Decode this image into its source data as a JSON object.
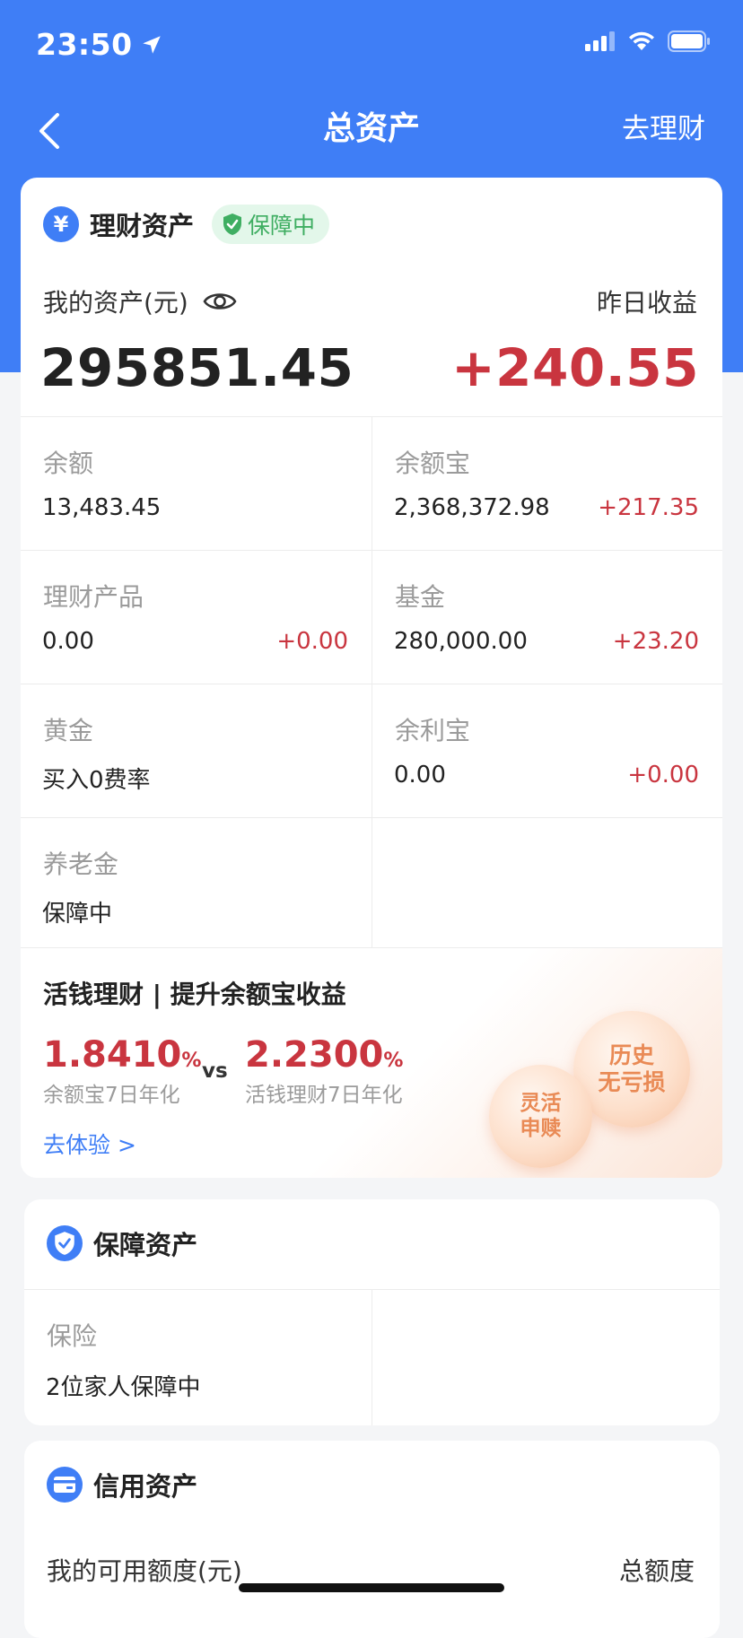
{
  "status_bar": {
    "time": "23:50"
  },
  "nav": {
    "title": "总资产",
    "action": "去理财"
  },
  "finance": {
    "title": "理财资产",
    "icon_glyph": "¥",
    "badge": "保障中",
    "assets_label": "我的资产(元)",
    "yesterday_label": "昨日收益",
    "total": "295851.45",
    "yesterday_income": "+240.55",
    "items": [
      {
        "label": "余额",
        "value": "13,483.45",
        "delta": ""
      },
      {
        "label": "余额宝",
        "value": "2,368,372.98",
        "delta": "+217.35"
      },
      {
        "label": "理财产品",
        "value": "0.00",
        "delta": "+0.00"
      },
      {
        "label": "基金",
        "value": "280,000.00",
        "delta": "+23.20"
      },
      {
        "label": "黄金",
        "value": "买入0费率",
        "delta": ""
      },
      {
        "label": "余利宝",
        "value": "0.00",
        "delta": "+0.00"
      },
      {
        "label": "养老金",
        "value": "保障中",
        "delta": ""
      }
    ],
    "promo": {
      "title": "活钱理财 | 提升余额宝收益",
      "rate_a": "1.8410",
      "rate_a_unit": "%",
      "rate_a_label": "余额宝7日年化",
      "vs": "vs",
      "rate_b": "2.2300",
      "rate_b_unit": "%",
      "rate_b_label": "活钱理财7日年化",
      "link": "去体验 >",
      "bubble_history_1": "历史",
      "bubble_history_2": "无亏损",
      "bubble_redeem_1": "灵活",
      "bubble_redeem_2": "申赎"
    }
  },
  "protect": {
    "title": "保障资产",
    "item_label": "保险",
    "item_value": "2位家人保障中"
  },
  "credit": {
    "title": "信用资产",
    "available_label": "我的可用额度(元)",
    "total_label": "总额度"
  },
  "colors": {
    "brand_blue": "#3f7ef6",
    "income_red": "#c9353f",
    "badge_green": "#3fae62"
  }
}
